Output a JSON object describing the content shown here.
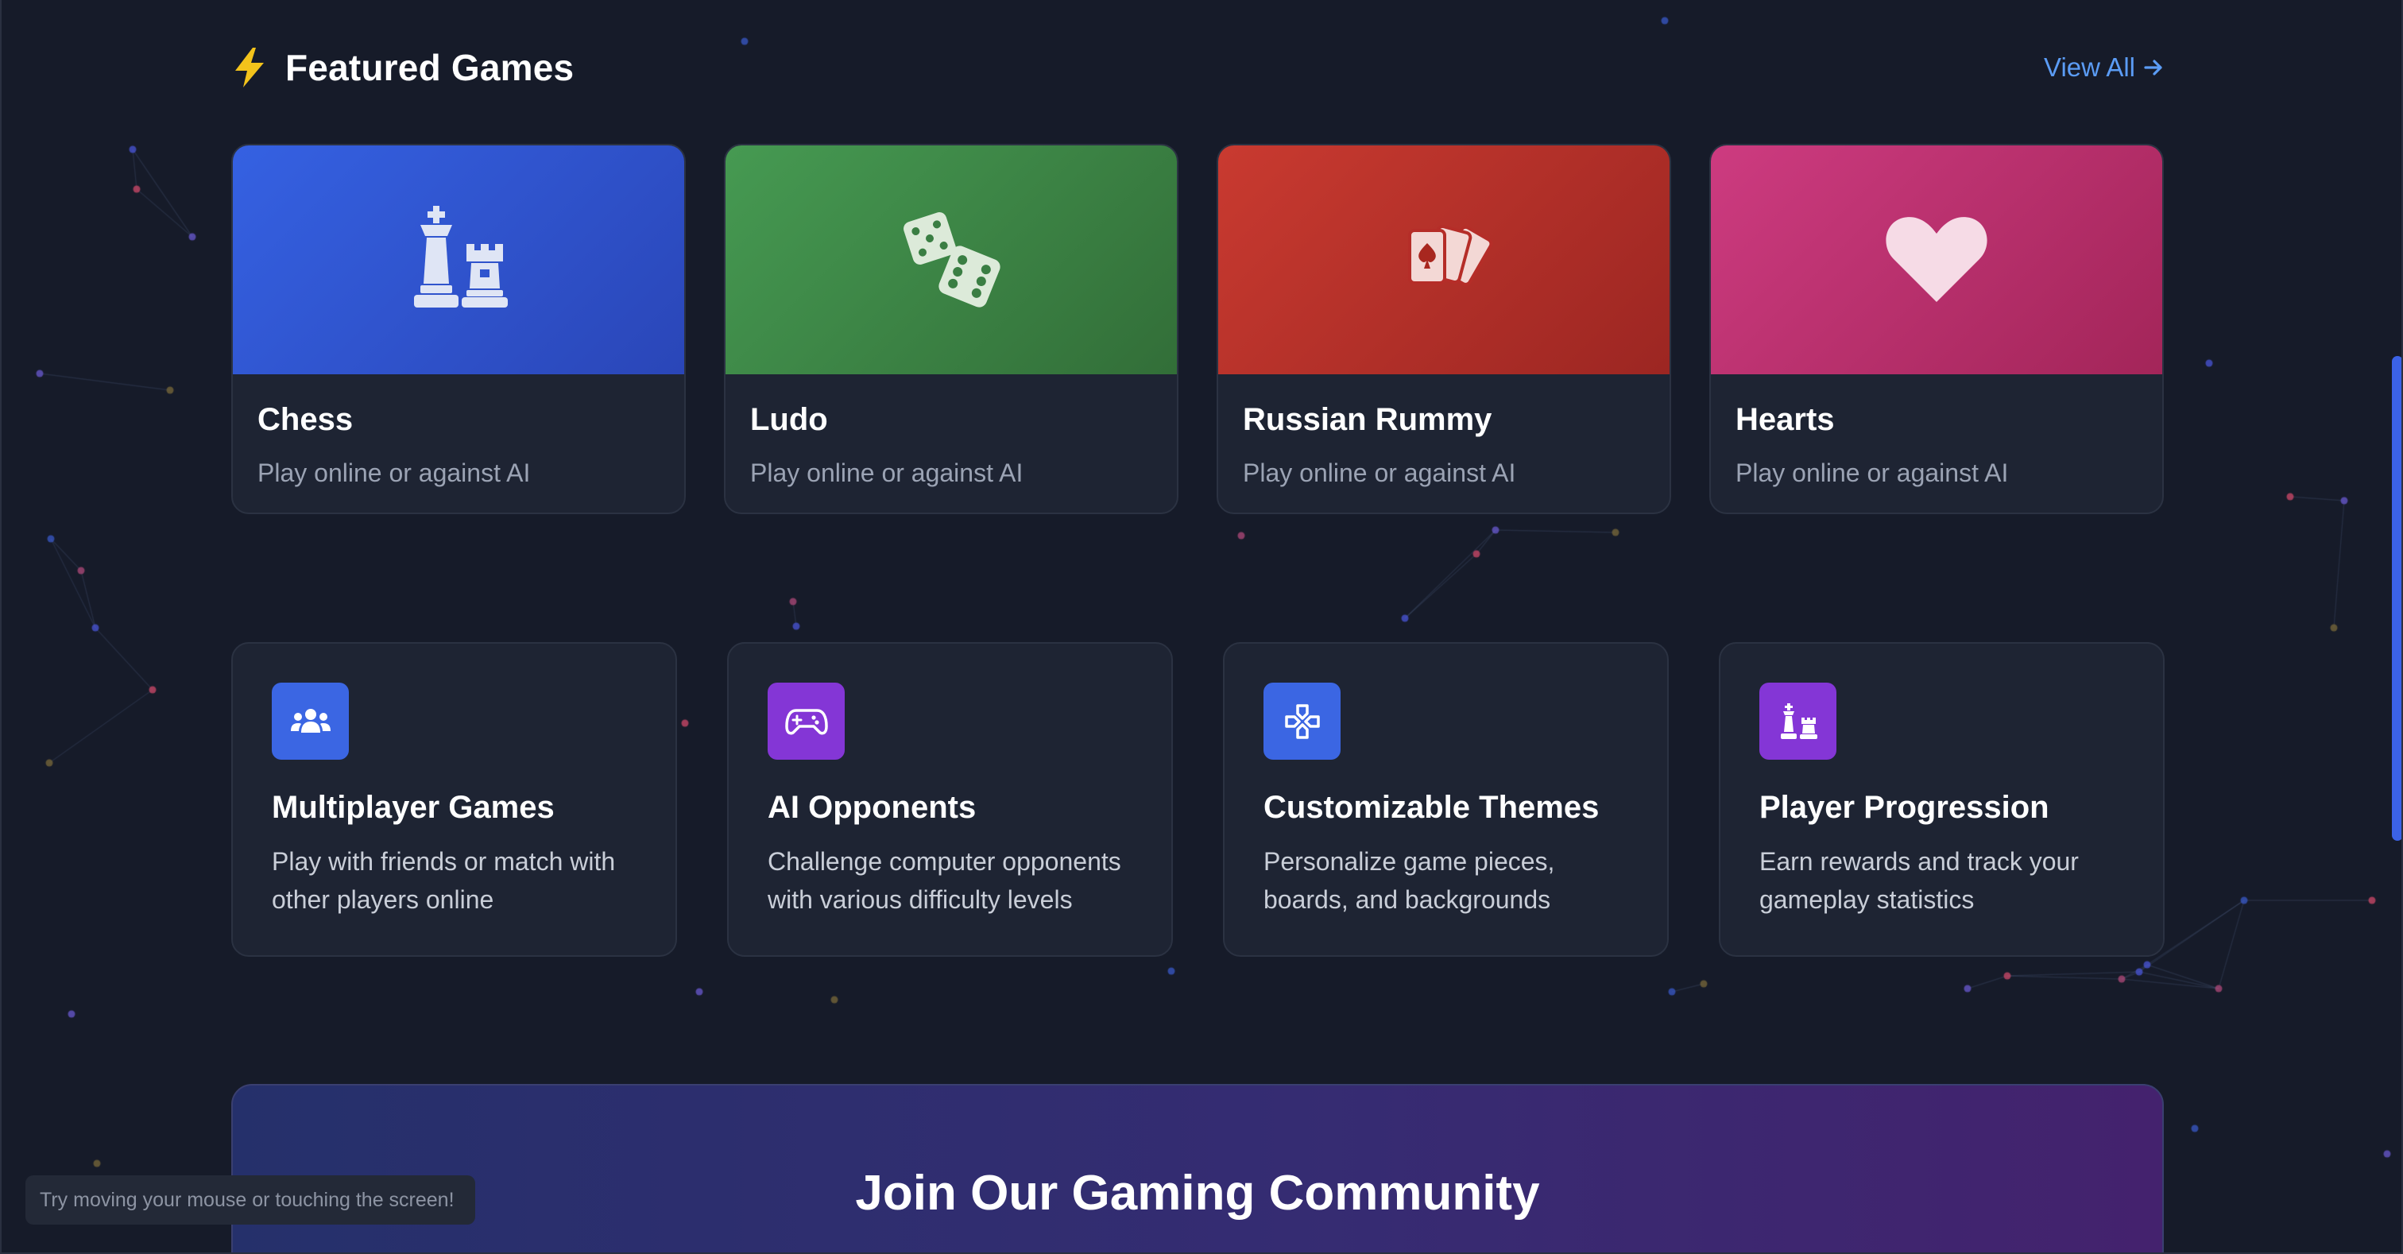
{
  "header": {
    "title": "Featured Games",
    "icon": "bolt-icon",
    "view_all": "View All"
  },
  "games": [
    {
      "name": "Chess",
      "subtitle": "Play online or against AI",
      "icon": "chess-icon",
      "color": "#3157d8"
    },
    {
      "name": "Ludo",
      "subtitle": "Play online or against AI",
      "icon": "dice-icon",
      "color": "#3c8c48"
    },
    {
      "name": "Russian Rummy",
      "subtitle": "Play online or against AI",
      "icon": "cards-icon",
      "color": "#b7302d"
    },
    {
      "name": "Hearts",
      "subtitle": "Play online or against AI",
      "icon": "heart-icon",
      "color": "#bb3474"
    }
  ],
  "features": [
    {
      "title": "Multiplayer Games",
      "description": "Play with friends or match with other players online",
      "icon": "users-icon",
      "color": "#3b66e3"
    },
    {
      "title": "AI Opponents",
      "description": "Challenge computer opponents with various difficulty levels",
      "icon": "gamepad-icon",
      "color": "#8436d6"
    },
    {
      "title": "Customizable Themes",
      "description": "Personalize game pieces, boards, and backgrounds",
      "icon": "dpad-icon",
      "color": "#3b66e3"
    },
    {
      "title": "Player Progression",
      "description": "Earn rewards and track your gameplay statistics",
      "icon": "chess-pieces-icon",
      "color": "#8436d6"
    }
  ],
  "community": {
    "title": "Join Our Gaming Community"
  },
  "hint": "Try moving your mouse or touching the screen!"
}
